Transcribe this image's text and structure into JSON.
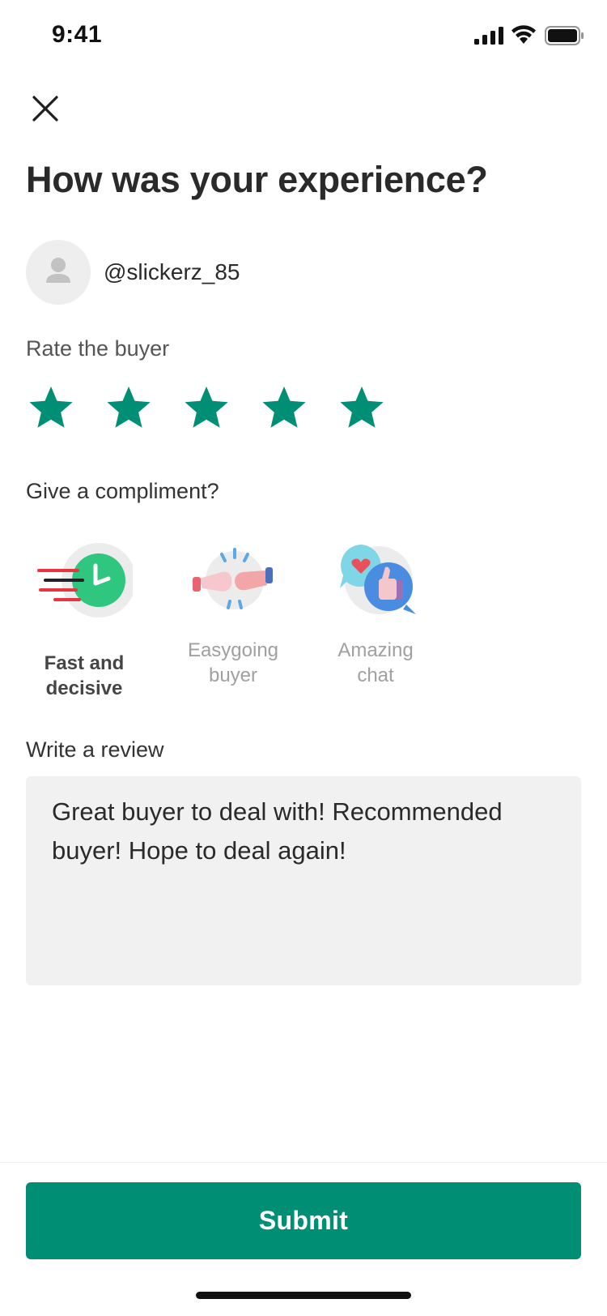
{
  "status_bar": {
    "time": "9:41"
  },
  "header": {
    "title": "How was your experience?"
  },
  "user": {
    "username": "@slickerz_85"
  },
  "rating": {
    "label": "Rate the buyer",
    "value": 5,
    "max": 5,
    "color": "#008f75"
  },
  "compliments": {
    "label": "Give a compliment?",
    "items": [
      {
        "line1": "Fast and",
        "line2": "decisive",
        "selected": true,
        "icon": "fast-clock-icon"
      },
      {
        "line1": "Easygoing",
        "line2": "buyer",
        "selected": false,
        "icon": "fist-bump-icon"
      },
      {
        "line1": "Amazing",
        "line2": "chat",
        "selected": false,
        "icon": "chat-thumbs-up-icon"
      }
    ]
  },
  "review": {
    "label": "Write a review",
    "value": "Great buyer to deal with! Recommended buyer! Hope to deal again!"
  },
  "footer": {
    "submit_label": "Submit",
    "accent": "#008f75"
  }
}
